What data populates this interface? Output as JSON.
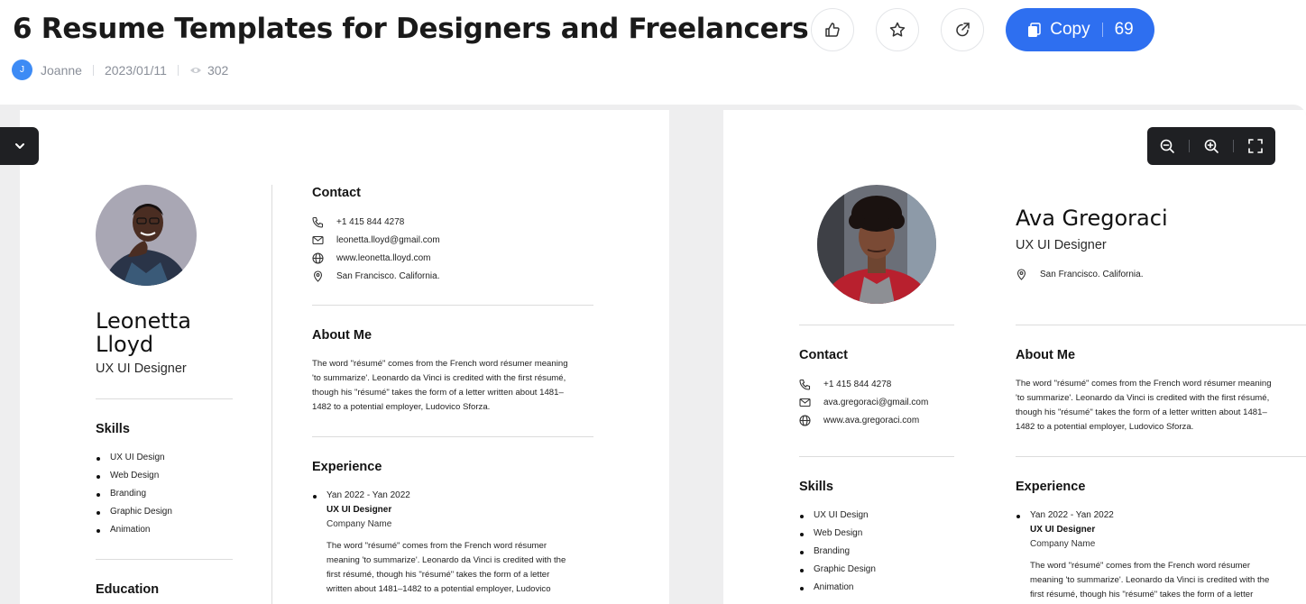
{
  "header": {
    "title": "6 Resume Templates for Designers and Freelancers",
    "author_initial": "J",
    "author": "Joanne",
    "date": "2023/01/11",
    "views": "302",
    "copy_label": "Copy",
    "copy_count": "69"
  },
  "colors": {
    "primary": "#2e6ff0",
    "toolbar": "#1f2023",
    "canvas": "#eeeeef"
  },
  "icons": [
    "thumbs-up-icon",
    "star-icon",
    "share-icon",
    "document-icon",
    "eye-icon",
    "chevron-down-icon",
    "zoom-out-icon",
    "zoom-in-icon",
    "fullscreen-icon",
    "phone-icon",
    "mail-icon",
    "globe-icon",
    "location-icon"
  ],
  "resume1": {
    "name_line1": "Leonetta",
    "name_line2": "Lloyd",
    "role": "UX UI Designer",
    "skills_heading": "Skills",
    "skills": [
      "UX UI Design",
      "Web Design",
      "Branding",
      "Graphic Design",
      "Animation"
    ],
    "education_heading": "Education",
    "contact_heading": "Contact",
    "phone": "+1 415 844 4278",
    "email": "leonetta.lloyd@gmail.com",
    "website": "www.leonetta.lloyd.com",
    "location": "San Francisco. California.",
    "about_heading": "About Me",
    "about_lines": [
      "The word \"résumé\" comes from the French word résumer meaning",
      "'to summarize'. Leonardo da Vinci is credited with the first résumé,",
      "though his \"résumé\" takes the form of a letter written about 1481–",
      "1482 to a potential employer, Ludovico Sforza."
    ],
    "experience_heading": "Experience",
    "exp_date": "Yan 2022 - Yan 2022",
    "exp_title": "UX UI Designer",
    "exp_company": "Company Name",
    "exp_lines": [
      "The word \"résumé\" comes from the French word résumer",
      "meaning 'to summarize'. Leonardo da Vinci is credited with the",
      "first résumé, though his \"résumé\" takes the form of a letter",
      "written about 1481–1482 to a potential employer, Ludovico"
    ]
  },
  "resume2": {
    "name": "Ava Gregoraci",
    "role": "UX UI Designer",
    "location": "San Francisco. California.",
    "contact_heading": "Contact",
    "phone": "+1 415 844 4278",
    "email": "ava.gregoraci@gmail.com",
    "website": "www.ava.gregoraci.com",
    "about_heading": "About Me",
    "about_lines": [
      "The word \"résumé\" comes from the French word résumer meaning",
      "'to summarize'. Leonardo da Vinci is credited with the first résumé,",
      "though his \"résumé\" takes the form of a letter written about 1481–",
      "1482 to a potential employer, Ludovico Sforza."
    ],
    "skills_heading": "Skills",
    "skills": [
      "UX UI Design",
      "Web Design",
      "Branding",
      "Graphic Design",
      "Animation"
    ],
    "experience_heading": "Experience",
    "exp_date": "Yan 2022 - Yan 2022",
    "exp_title": "UX UI Designer",
    "exp_company": "Company Name",
    "exp_lines": [
      "The word \"résumé\" comes from the French word résumer",
      "meaning 'to summarize'. Leonardo da Vinci is credited with the",
      "first résumé, though his \"résumé\" takes the form of a letter"
    ]
  }
}
